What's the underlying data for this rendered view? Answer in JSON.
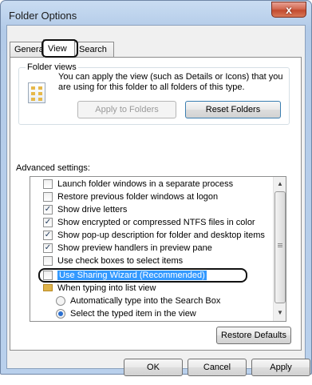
{
  "window": {
    "title": "Folder Options",
    "close_glyph": "x"
  },
  "tabs": [
    {
      "label": "General",
      "active": false
    },
    {
      "label": "View",
      "active": true
    },
    {
      "label": "Search",
      "active": false
    }
  ],
  "folder_views": {
    "group_title": "Folder views",
    "description": "You can apply the view (such as Details or Icons) that you are using for this folder to all folders of this type.",
    "apply_button": "Apply to Folders",
    "reset_button": "Reset Folders",
    "icon": "folder-view-icon"
  },
  "advanced": {
    "label": "Advanced settings:",
    "items": [
      {
        "type": "checkbox",
        "label": "Launch folder windows in a separate process",
        "checked": false
      },
      {
        "type": "checkbox",
        "label": "Restore previous folder windows at logon",
        "checked": false
      },
      {
        "type": "checkbox",
        "label": "Show drive letters",
        "checked": true
      },
      {
        "type": "checkbox",
        "label": "Show encrypted or compressed NTFS files in color",
        "checked": true
      },
      {
        "type": "checkbox",
        "label": "Show pop-up description for folder and desktop items",
        "checked": true
      },
      {
        "type": "checkbox",
        "label": "Show preview handlers in preview pane",
        "checked": true
      },
      {
        "type": "checkbox",
        "label": "Use check boxes to select items",
        "checked": false
      },
      {
        "type": "checkbox",
        "label": "Use Sharing Wizard (Recommended)",
        "checked": false,
        "selected": true
      },
      {
        "type": "folder",
        "label": "When typing into list view"
      },
      {
        "type": "radio",
        "label": "Automatically type into the Search Box",
        "checked": false
      },
      {
        "type": "radio",
        "label": "Select the typed item in the view",
        "checked": true
      }
    ],
    "restore_button": "Restore Defaults"
  },
  "footer": {
    "ok": "OK",
    "cancel": "Cancel",
    "apply": "Apply"
  },
  "glyphs": {
    "check": "✓",
    "scroll_up": "▲",
    "scroll_down": "▼"
  },
  "colors": {
    "selection": "#3399ff",
    "titlebar": "#c9dcf2",
    "close_button": "#c24a2e"
  }
}
